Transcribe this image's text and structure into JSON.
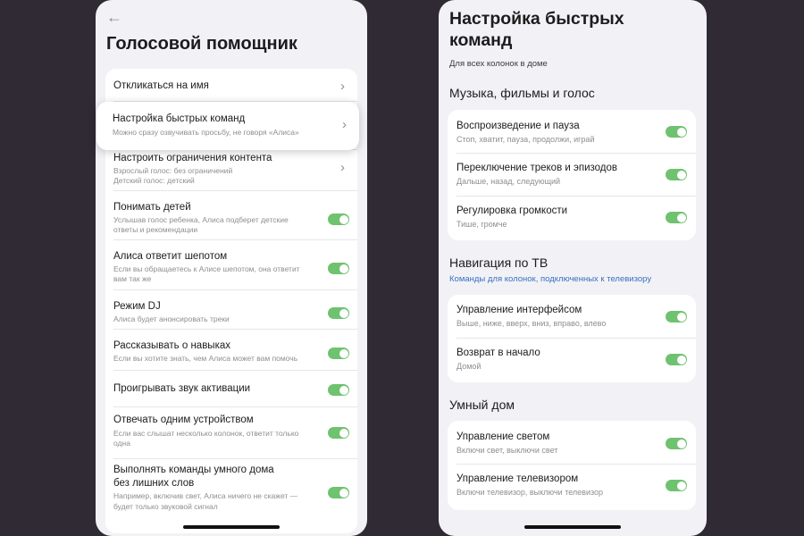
{
  "left": {
    "title": "Голосовой помощник",
    "back_icon": "arrow-left-icon",
    "items": [
      {
        "label": "Откликаться на имя",
        "control": "chevron"
      },
      {
        "label": "Настройка быстрых команд",
        "sub": [
          "Можно сразу озвучивать просьбу, не говоря «Алиса»"
        ],
        "control": "chevron"
      },
      {
        "label": "Настроить ограничения контента",
        "sub": [
          "Взрослый голос: без ограничений",
          "Детский голос: детский"
        ],
        "control": "chevron"
      },
      {
        "label": "Понимать детей",
        "sub": [
          "Услышав голос ребенка, Алиса подберет детские",
          "ответы и рекомендации"
        ],
        "control": "toggle",
        "on": true
      },
      {
        "label": "Алиса ответит шепотом",
        "sub": [
          "Если вы обращаетесь к Алисе шепотом, она ответит",
          "вам так же"
        ],
        "control": "toggle",
        "on": true
      },
      {
        "label": "Режим DJ",
        "sub": [
          "Алиса будет анонсировать треки"
        ],
        "control": "toggle",
        "on": true
      },
      {
        "label": "Рассказывать о навыках",
        "sub": [
          "Если вы хотите знать, чем Алиса может вам помочь"
        ],
        "control": "toggle",
        "on": true
      },
      {
        "label": "Проигрывать звук активации",
        "control": "toggle",
        "on": true
      },
      {
        "label": "Отвечать одним устройством",
        "sub": [
          "Если вас слышат несколько колонок, ответит только",
          "одна"
        ],
        "control": "toggle",
        "on": true
      },
      {
        "label": [
          "Выполнять команды умного дома",
          "без лишних слов"
        ],
        "sub": [
          "Например, включив свет, Алиса ничего не скажет —",
          "будет только звуковой сигнал"
        ],
        "control": "toggle",
        "on": true
      }
    ]
  },
  "right": {
    "title_lines": [
      "Настройка быстрых",
      "команд"
    ],
    "subtitle": "Для всех колонок в доме",
    "sections": [
      {
        "title": "Музыка, фильмы и голос",
        "items": [
          {
            "label": "Воспроизведение и пауза",
            "sub": "Стоп, хватит, пауза, продолжи, играй",
            "on": true
          },
          {
            "label": "Переключение треков и эпизодов",
            "sub": "Дальше, назад, следующий",
            "on": true
          },
          {
            "label": "Регулировка громкости",
            "sub": "Тише, громче",
            "on": true
          }
        ]
      },
      {
        "title": "Навигация по ТВ",
        "subtitle": "Команды для колонок, подключенных к телевизору",
        "items": [
          {
            "label": "Управление интерфейсом",
            "sub": "Выше, ниже, вверх, вниз, вправо, влево",
            "on": true
          },
          {
            "label": "Возврат в начало",
            "sub": "Домой",
            "on": true
          }
        ]
      },
      {
        "title": "Умный дом",
        "items": [
          {
            "label": "Управление светом",
            "sub": "Включи свет, выключи свет",
            "on": true
          },
          {
            "label": "Управление телевизором",
            "sub": "Включи телевизор, выключи телевизор",
            "on": true
          }
        ]
      }
    ]
  },
  "colors": {
    "background": "#2f2a34",
    "screen": "#f2f2f6",
    "card": "#ffffff",
    "toggle_on": "#6fc26f",
    "section_subtitle": "#3a6fc2"
  }
}
